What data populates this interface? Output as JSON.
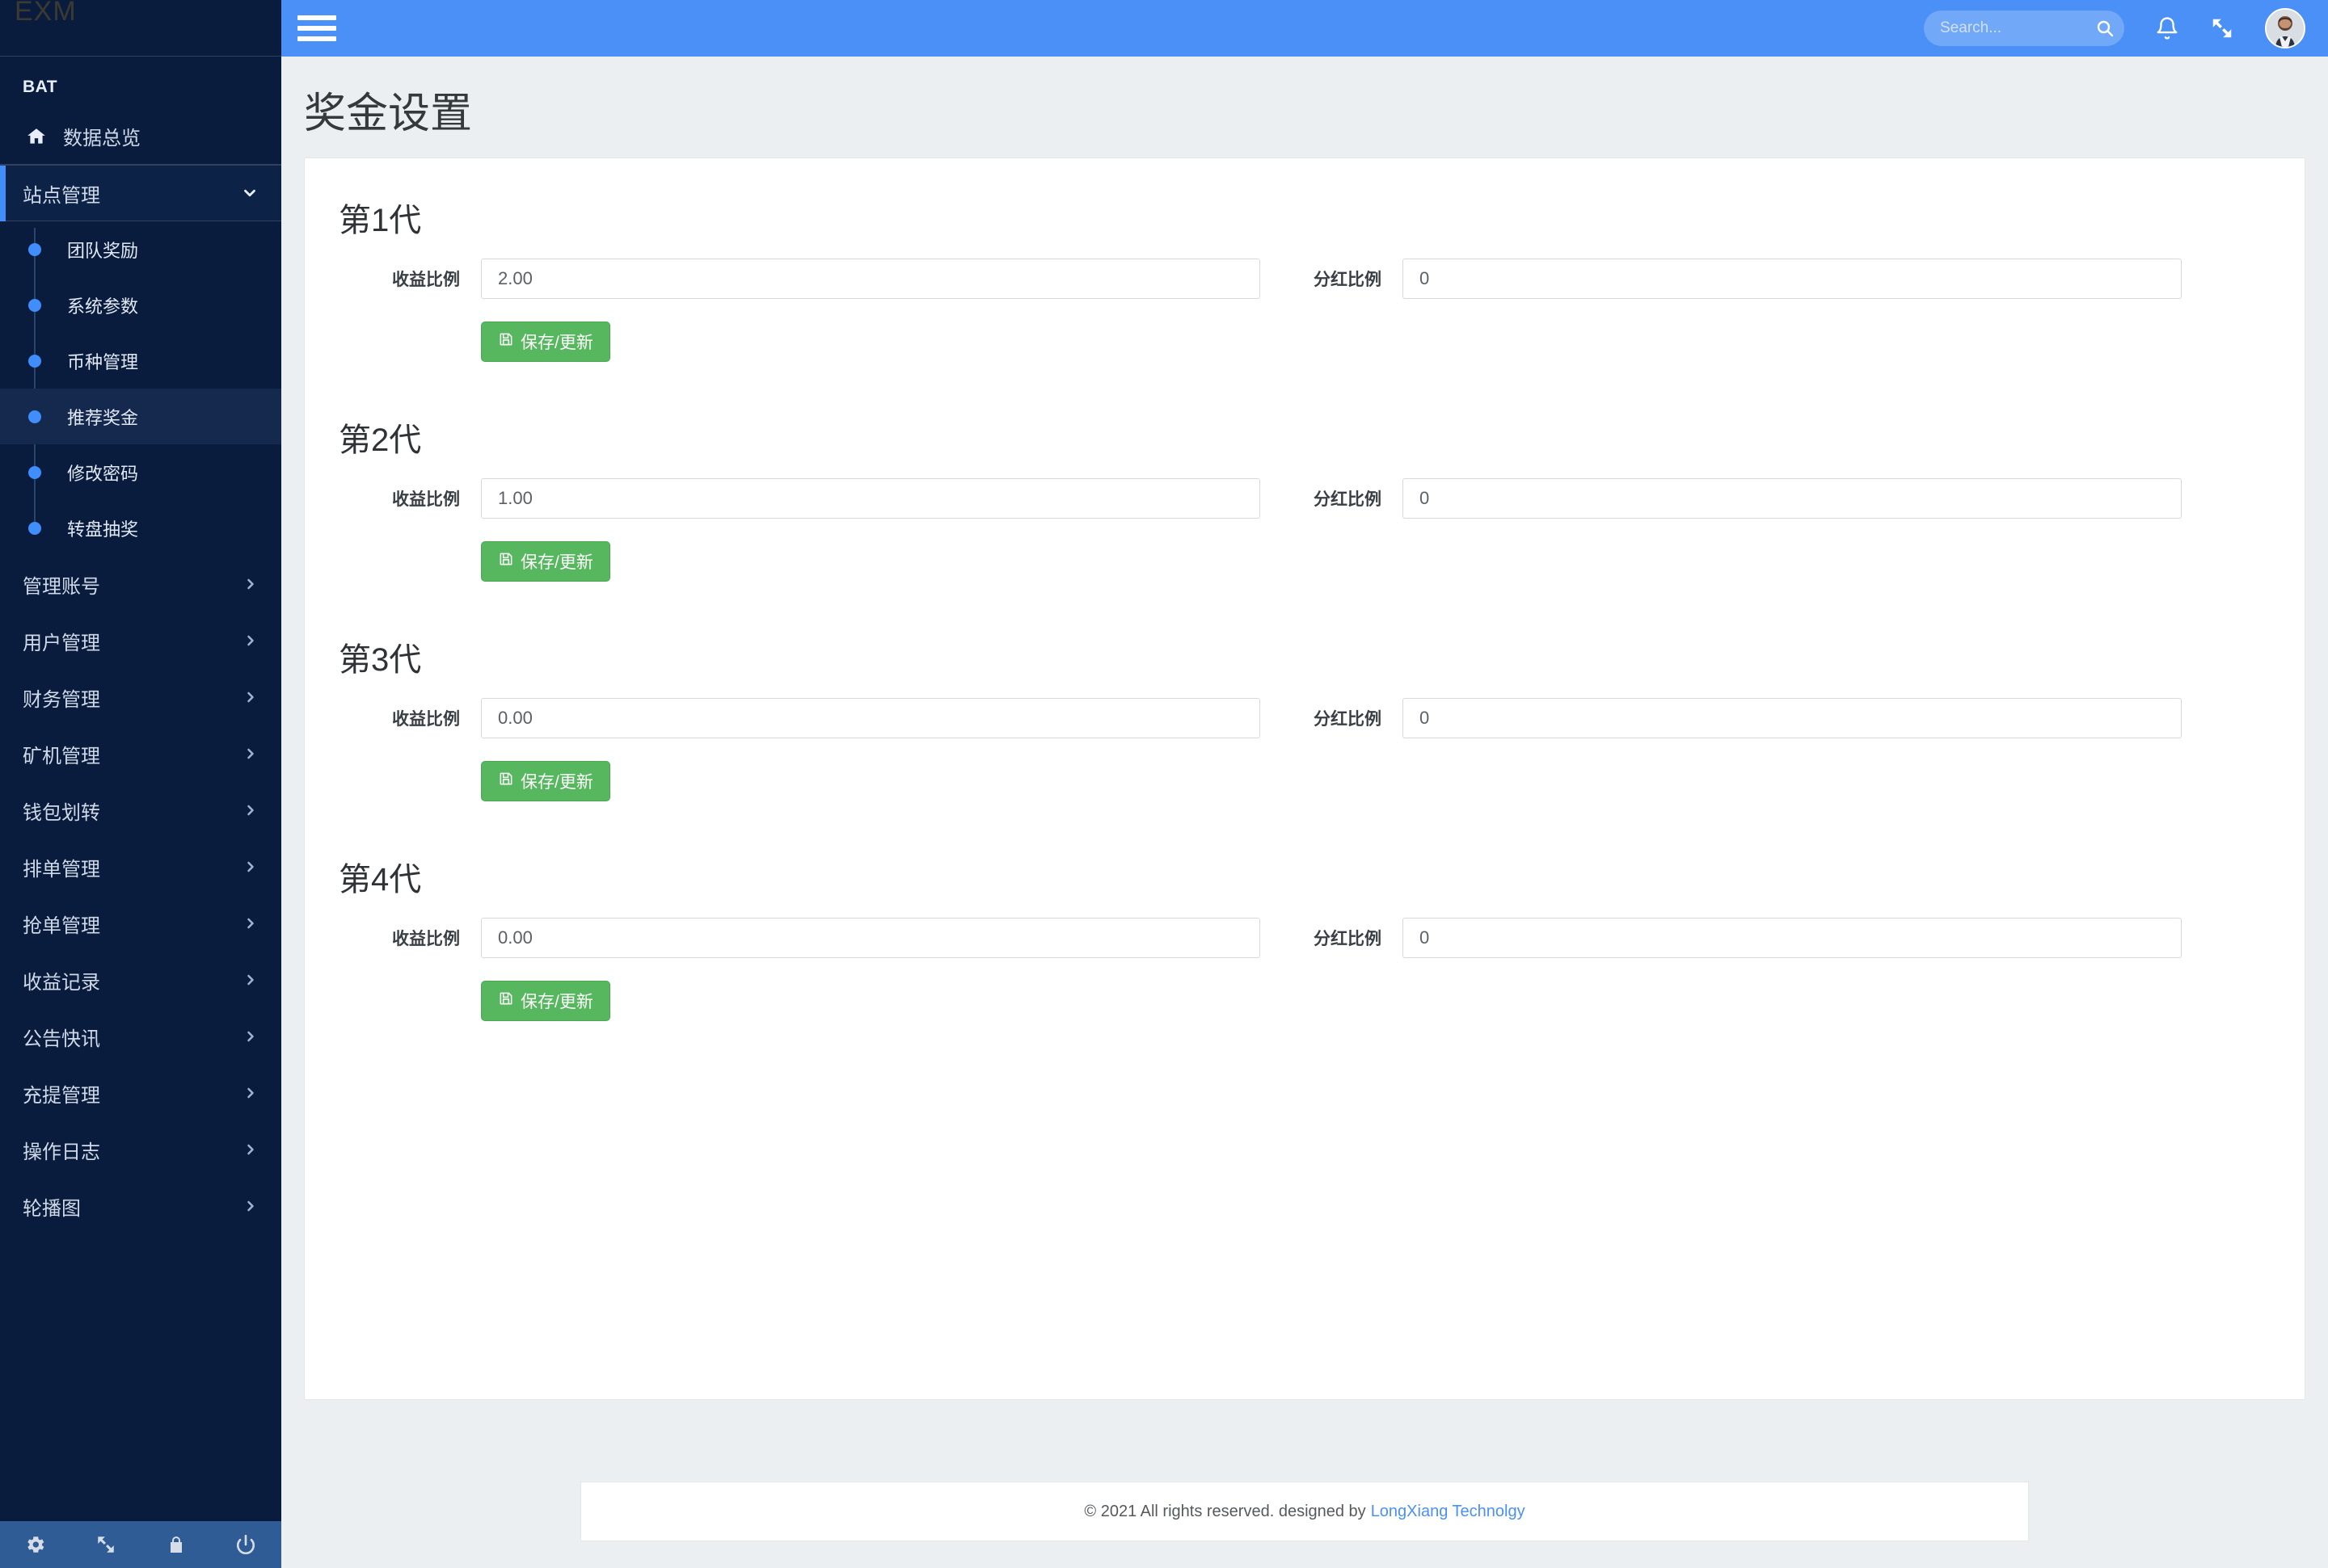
{
  "brand": {
    "logo_text": "EXM",
    "section_label": "BAT"
  },
  "topbar": {
    "menu_toggle_label": "",
    "search": {
      "placeholder": "Search...",
      "value": ""
    },
    "icons": [
      "bell-icon",
      "fullscreen-icon",
      "avatar"
    ]
  },
  "sidebar": {
    "dashboard": {
      "label": "数据总览",
      "icon": "home-icon"
    },
    "site_mgmt": {
      "label": "站点管理",
      "icon": "chevron-down-icon",
      "expanded": true
    },
    "submenu": [
      {
        "label": "团队奖励",
        "active": false
      },
      {
        "label": "系统参数",
        "active": false
      },
      {
        "label": "币种管理",
        "active": false
      },
      {
        "label": "推荐奖金",
        "active": true
      },
      {
        "label": "修改密码",
        "active": false
      },
      {
        "label": "转盘抽奖",
        "active": false
      }
    ],
    "items": [
      {
        "label": "管理账号",
        "icon": "chevron-right-icon"
      },
      {
        "label": "用户管理",
        "icon": "chevron-right-icon"
      },
      {
        "label": "财务管理",
        "icon": "chevron-right-icon"
      },
      {
        "label": "矿机管理",
        "icon": "chevron-right-icon"
      },
      {
        "label": "钱包划转",
        "icon": "chevron-right-icon"
      },
      {
        "label": "排单管理",
        "icon": "chevron-right-icon"
      },
      {
        "label": "抢单管理",
        "icon": "chevron-right-icon"
      },
      {
        "label": "收益记录",
        "icon": "chevron-right-icon"
      },
      {
        "label": "公告快讯",
        "icon": "chevron-right-icon"
      },
      {
        "label": "充提管理",
        "icon": "chevron-right-icon"
      },
      {
        "label": "操作日志",
        "icon": "chevron-right-icon"
      },
      {
        "label": "轮播图",
        "icon": "chevron-right-icon"
      }
    ],
    "footer_icons": [
      "gear-icon",
      "fullscreen-icon",
      "lock-icon",
      "power-icon"
    ]
  },
  "main": {
    "page_title": "奖金设置",
    "labels": {
      "profit_ratio": "收益比例",
      "dividend_ratio": "分红比例"
    },
    "save_button": "保存/更新",
    "generations": [
      {
        "title": "第1代",
        "profit_ratio": "2.00",
        "dividend_ratio": "0"
      },
      {
        "title": "第2代",
        "profit_ratio": "1.00",
        "dividend_ratio": "0"
      },
      {
        "title": "第3代",
        "profit_ratio": "0.00",
        "dividend_ratio": "0"
      },
      {
        "title": "第4代",
        "profit_ratio": "0.00",
        "dividend_ratio": "0"
      }
    ]
  },
  "footer": {
    "copyright": "© 2021 All rights reserved. designed by",
    "company": "LongXiang Technolgy"
  },
  "colors": {
    "sidebar_bg": "#0a1c3d",
    "topbar_blue": "#4a90f7",
    "accent_blue": "#3f8efc",
    "save_green": "#57b75f",
    "content_bg": "#eceff1"
  }
}
